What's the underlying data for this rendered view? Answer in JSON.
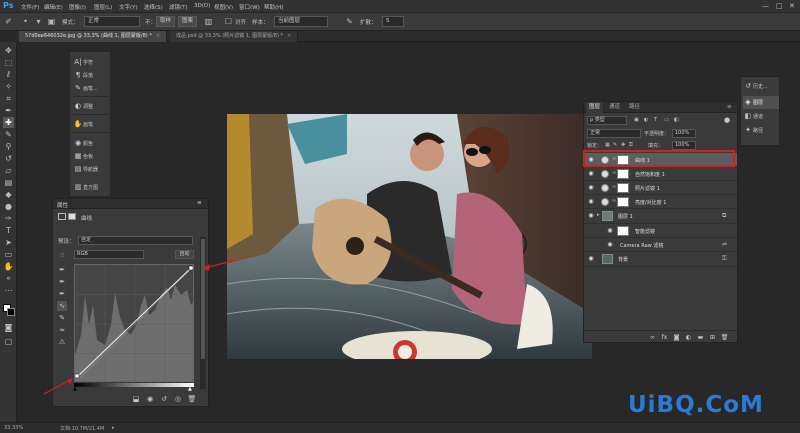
{
  "app": {
    "logo": "Ps"
  },
  "menubar": {
    "items": [
      "文件(F)",
      "编辑(E)",
      "图像(I)",
      "图层(L)",
      "文字(Y)",
      "选择(S)",
      "滤镜(T)",
      "3D(D)",
      "视图(V)",
      "窗口(W)",
      "帮助(H)"
    ],
    "minimize": "—",
    "maximize": "□",
    "close": "✕"
  },
  "options": {
    "mode_label": "模式：",
    "mode_value": "正常",
    "opacity_label": "不：",
    "button_a": "取样",
    "button_b": "图案",
    "checkbox_label": "对齐",
    "sample_label": "样本：",
    "sample_value": "当前图层",
    "spread_label": "扩散：",
    "spread_value": "5"
  },
  "tabs": [
    {
      "label": "57d0ee646032e.jpg @ 33.3% (曲线 1, 图层蒙版/8) *",
      "active": true
    },
    {
      "label": "成品.psd @ 33.3% (照片滤镜 1, 图层蒙版/8) *",
      "active": false
    }
  ],
  "panel_strip": {
    "items": [
      {
        "icon": "A|",
        "label": "字符"
      },
      {
        "icon": "¶",
        "label": "段落"
      },
      {
        "icon": "✎",
        "label": "画笔..."
      },
      {
        "icon": "◐",
        "label": "调整"
      },
      {
        "icon": "✋",
        "label": "画笔"
      },
      {
        "icon": "◉",
        "label": "颜色"
      },
      {
        "icon": "▦",
        "label": "色板"
      },
      {
        "icon": "▤",
        "label": "导航器"
      },
      {
        "icon": "▥",
        "label": "直方图"
      }
    ]
  },
  "properties": {
    "title": "属性",
    "subtitle": "曲线",
    "preset_label": "预设：",
    "preset_value": "自定",
    "channel_value": "RGB",
    "auto_button": "自动"
  },
  "layers": {
    "tabs": [
      "图层",
      "通道",
      "路径"
    ],
    "filter_kind": "ρ 类型",
    "blend_mode": "正常",
    "opacity_label": "不透明度：",
    "opacity_value": "100%",
    "lock_label": "锁定：",
    "fill_label": "填充：",
    "fill_value": "100%",
    "items": [
      {
        "name": "曲线 1",
        "selected": true,
        "kind": "adjustment"
      },
      {
        "name": "自然饱和度 1",
        "selected": false,
        "kind": "adjustment"
      },
      {
        "name": "照片滤镜 1",
        "selected": false,
        "kind": "adjustment"
      },
      {
        "name": "亮度/对比度 1",
        "selected": false,
        "kind": "adjustment"
      },
      {
        "name": "图层 1",
        "selected": false,
        "kind": "smart"
      },
      {
        "name": "智能滤镜",
        "selected": false,
        "kind": "filter-mask"
      },
      {
        "name": "Camera Raw 滤镜",
        "selected": false,
        "kind": "filter"
      },
      {
        "name": "背景",
        "selected": false,
        "kind": "background"
      }
    ]
  },
  "mini_panel": {
    "items": [
      {
        "icon": "↺",
        "label": "历史..."
      },
      {
        "icon": "◈",
        "label": "图层"
      },
      {
        "icon": "◧",
        "label": "通道"
      },
      {
        "icon": "✦",
        "label": "路径"
      }
    ]
  },
  "status": {
    "zoom": "33.33%",
    "doc": "文档:10.7M/21.4M"
  },
  "watermark": "UiBQ.CoM",
  "colors": {
    "highlight": "#d21e2b",
    "watermark": "#2b7bd6",
    "logo": "#31a8ff"
  }
}
